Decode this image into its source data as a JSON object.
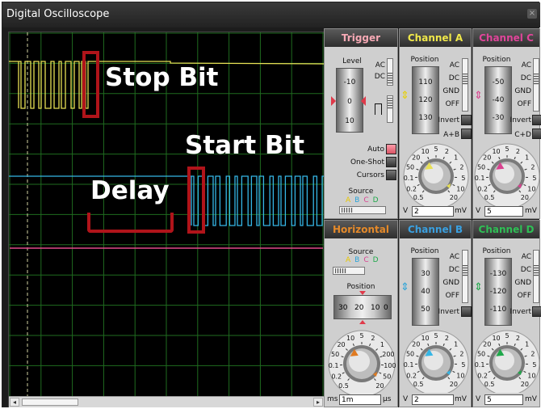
{
  "window": {
    "title": "Digital Oscilloscope",
    "close_glyph": "×"
  },
  "annotations": {
    "stop_bit": "Stop Bit",
    "start_bit": "Start Bit",
    "delay": "Delay",
    "highlight_color": "#b0141a"
  },
  "traces": {
    "a_color": "#e8e055",
    "b_color": "#35b6e6",
    "c_color": "#e04a8a",
    "d_color": "#2bb24c",
    "grid_color": "#1f6b1f"
  },
  "trigger": {
    "title": "Trigger",
    "level_label": "Level",
    "ac": "AC",
    "dc": "DC",
    "drum": [
      "-10",
      "0",
      "10"
    ],
    "auto": "Auto",
    "one_shot": "One-Shot",
    "cursors": "Cursors",
    "source_label": "Source",
    "sources": [
      "A",
      "B",
      "C",
      "D"
    ]
  },
  "channel_a": {
    "title": "Channel A",
    "position_label": "Position",
    "drum": [
      "110",
      "120",
      "130"
    ],
    "ac": "AC",
    "dc": "DC",
    "gnd": "GND",
    "off": "OFF",
    "invert": "Invert",
    "sum": "A+B",
    "dial": [
      "0.5",
      "0.2",
      "0.1",
      "50",
      "20",
      "10",
      "5",
      "2",
      "1",
      "2",
      "5",
      "10",
      "20"
    ],
    "unit_left": "V",
    "value": "2",
    "unit_right": "mV",
    "color": "#e8e055"
  },
  "channel_b": {
    "title": "Channel B",
    "position_label": "Position",
    "drum": [
      "30",
      "40",
      "50"
    ],
    "ac": "AC",
    "dc": "DC",
    "gnd": "GND",
    "off": "OFF",
    "invert": "Invert",
    "dial": [
      "0.5",
      "0.2",
      "0.1",
      "50",
      "20",
      "10",
      "5",
      "2",
      "1",
      "2",
      "5",
      "10",
      "20"
    ],
    "unit_left": "V",
    "value": "2",
    "unit_right": "mV",
    "color": "#35b6e6"
  },
  "channel_c": {
    "title": "Channel C",
    "position_label": "Position",
    "drum": [
      "-50",
      "-40",
      "-30"
    ],
    "ac": "AC",
    "dc": "DC",
    "gnd": "GND",
    "off": "OFF",
    "invert": "Invert",
    "sum": "C+D",
    "dial": [
      "0.5",
      "0.2",
      "0.1",
      "50",
      "20",
      "10",
      "5",
      "2",
      "1",
      "2",
      "5",
      "10",
      "20"
    ],
    "unit_left": "V",
    "value": "5",
    "unit_right": "mV",
    "color": "#d9418f"
  },
  "channel_d": {
    "title": "Channel D",
    "position_label": "Position",
    "drum": [
      "-130",
      "-120",
      "-110"
    ],
    "ac": "AC",
    "dc": "DC",
    "gnd": "GND",
    "off": "OFF",
    "invert": "Invert",
    "dial": [
      "0.5",
      "0.2",
      "0.1",
      "50",
      "20",
      "10",
      "5",
      "2",
      "1",
      "2",
      "5",
      "10",
      "20"
    ],
    "unit_left": "V",
    "value": "5",
    "unit_right": "mV",
    "color": "#1fa84a"
  },
  "horizontal": {
    "title": "Horizontal",
    "source_label": "Source",
    "sources": [
      "A",
      "B",
      "C",
      "D"
    ],
    "position_label": "Position",
    "ruler": [
      "30",
      "20",
      "10",
      "0"
    ],
    "dial": [
      "0.5",
      "0.2",
      "0.1",
      "50",
      "20",
      "10",
      "5",
      "2",
      "1",
      "200",
      "100",
      "50",
      "20"
    ],
    "unit_left": "ms",
    "value": "1m",
    "unit_right": "µs",
    "color": "#e07a20"
  },
  "scrollbar": {
    "left": "◂",
    "right": "▸"
  }
}
